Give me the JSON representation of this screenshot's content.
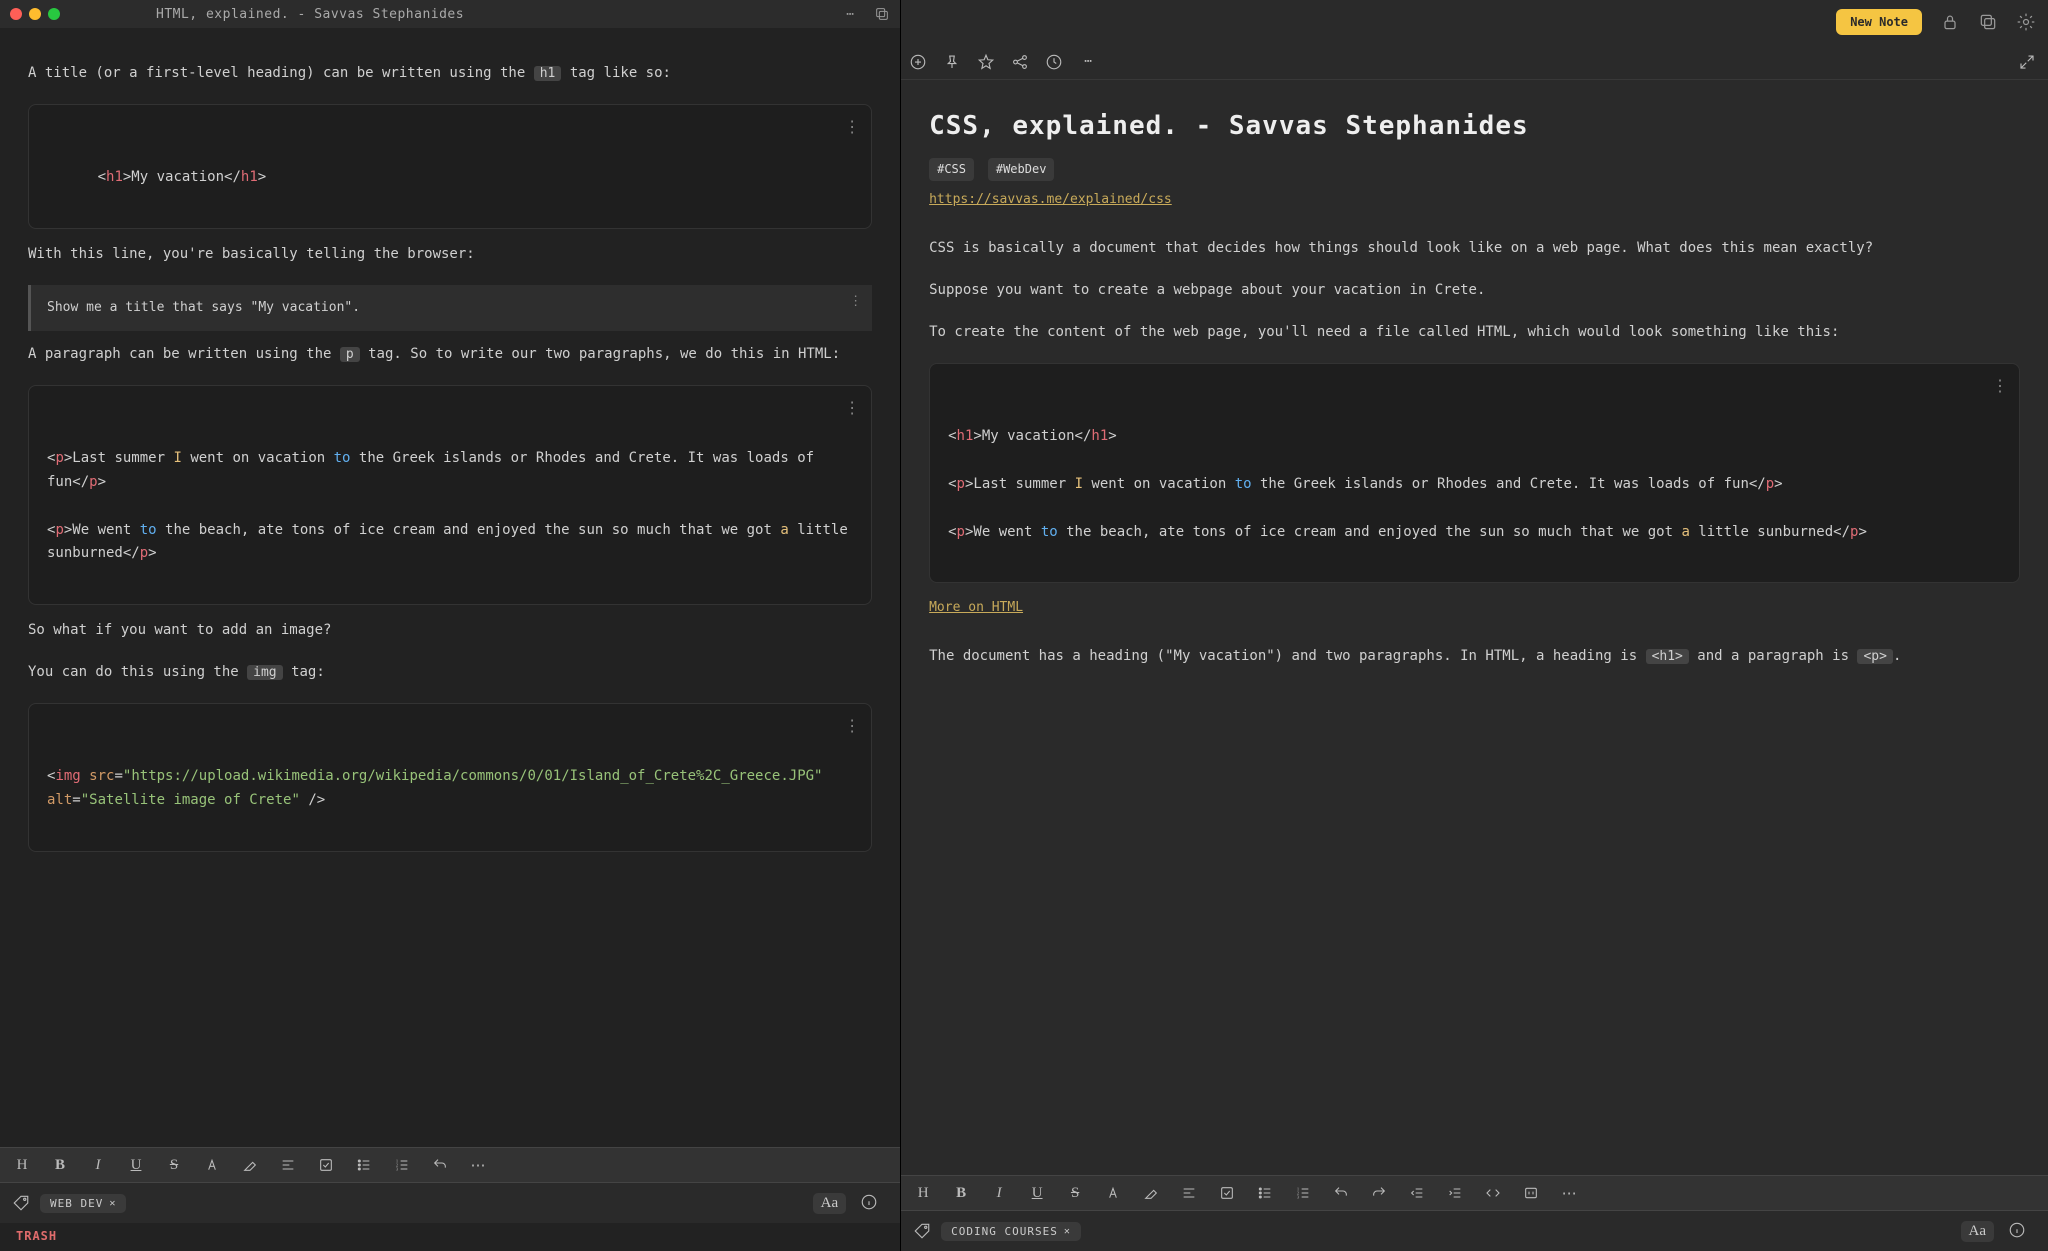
{
  "leftWindow": {
    "title": "HTML, explained. - Savvas Stephanides",
    "body": {
      "intro_a": "A title (or a first-level heading) can be written using the ",
      "intro_pill": "h1",
      "intro_b": " tag like so:",
      "code1": "<h1>My vacation</h1>",
      "line2": "With this line, you're basically telling the browser:",
      "quote": "Show me a title that says \"My vacation\".",
      "para2_a": "A paragraph can be written using the ",
      "para2_pill": "p",
      "para2_b": " tag. So to write our two paragraphs, we do this in HTML:",
      "code2_l1": "<p>Last summer I went on vacation to the Greek islands or Rhodes and Crete. It was loads of fun</p>",
      "code2_l2": "<p>We went to the beach, ate tons of ice cream and enjoyed the sun so much that we got a little sunburned</p>",
      "para3": "So what if you want to add an image?",
      "para4_a": "You can do this using the ",
      "para4_pill": "img",
      "para4_b": " tag:",
      "code3": "<img src=\"https://upload.wikimedia.org/wikipedia/commons/0/01/Island_of_Crete%2C_Greece.JPG\" alt=\"Satellite image of Crete\" />"
    },
    "statusTag": "WEB DEV",
    "trash": "TRASH"
  },
  "rightWindow": {
    "newNote": "New Note",
    "title": "CSS, explained. - Savvas Stephanides",
    "tags": [
      "#CSS",
      "#WebDev"
    ],
    "link": "https://savvas.me/explained/css",
    "p1": "CSS is basically a document that decides how things should look like on a web page. What does this mean exactly?",
    "p2": "Suppose you want to create a webpage about your vacation in Crete.",
    "p3": "To create the content of the web page, you'll need a file called HTML, which would look something like this:",
    "code_l1": "<h1>My vacation</h1>",
    "code_l2": "<p>Last summer I went on vacation to the Greek islands or Rhodes and Crete. It was loads of fun</p>",
    "code_l3": "<p>We went to the beach, ate tons of ice cream and enjoyed the sun so much that we got a little sunburned</p>",
    "moreLink": "More on HTML",
    "p4_a": "The document has a heading (\"My vacation\") and two paragraphs. In HTML, a heading is ",
    "p4_pill1": "<h1>",
    "p4_b": " and a paragraph is ",
    "p4_pill2": "<p>",
    "p4_c": ".",
    "statusTag": "CODING COURSES"
  }
}
